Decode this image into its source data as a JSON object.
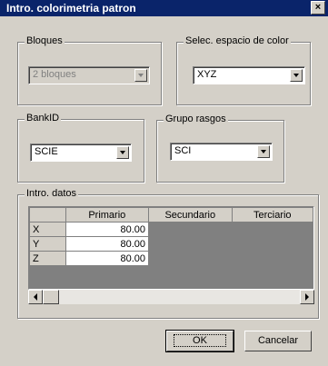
{
  "window": {
    "title": "Intro. colorimetria patron",
    "close_label": "×"
  },
  "bloques": {
    "legend": "Bloques",
    "value": "2 bloques"
  },
  "espacio": {
    "legend": "Selec. espacio de color",
    "value": "XYZ"
  },
  "bankid": {
    "legend": "BankID",
    "value": "SCIE"
  },
  "rasgos": {
    "legend": "Grupo rasgos",
    "value": "SCI"
  },
  "datos": {
    "legend": "Intro. datos",
    "columns": [
      "Primario",
      "Secundario",
      "Terciario"
    ],
    "rows": [
      {
        "label": "X",
        "primario": "80.00"
      },
      {
        "label": "Y",
        "primario": "80.00"
      },
      {
        "label": "Z",
        "primario": "80.00"
      }
    ]
  },
  "buttons": {
    "ok": "OK",
    "cancel": "Cancelar"
  }
}
